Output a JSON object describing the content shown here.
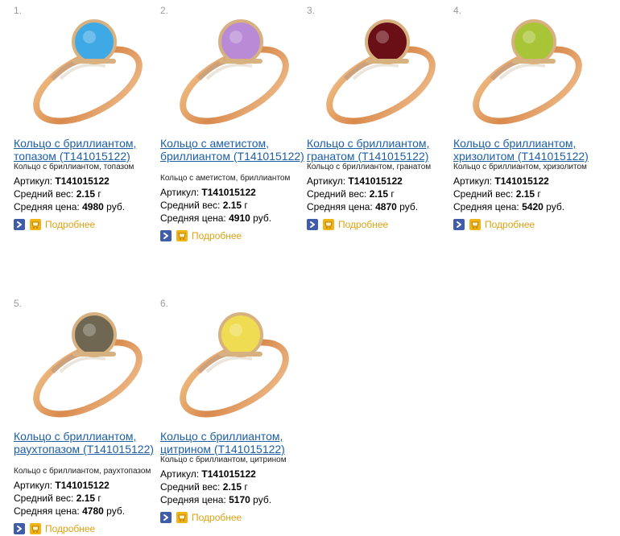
{
  "products": [
    {
      "index": "1.",
      "title": "Кольцо с бриллиантом, топазом (Т141015122)",
      "tags": "Кольцо с бриллиантом, топазом",
      "sku_label": "Артикул:",
      "sku": "Т141015122",
      "weight_label": "Средний вес:",
      "weight": "2.15",
      "weight_unit": "г",
      "price_label": "Средняя цена:",
      "price": "4980",
      "currency": "руб.",
      "more_label": "Подробнее",
      "stone_color": "#3fa9e6"
    },
    {
      "index": "2.",
      "title": "Кольцо с аметистом, бриллиантом (Т141015122)",
      "tags": "Кольцо с аметистом, бриллиантом",
      "sku_label": "Артикул:",
      "sku": "Т141015122",
      "weight_label": "Средний вес:",
      "weight": "2.15",
      "weight_unit": "г",
      "price_label": "Средняя цена:",
      "price": "4910",
      "currency": "руб.",
      "more_label": "Подробнее",
      "stone_color": "#b98bd6"
    },
    {
      "index": "3.",
      "title": "Кольцо с бриллиантом, гранатом (Т141015122)",
      "tags": "Кольцо с бриллиантом, гранатом",
      "sku_label": "Артикул:",
      "sku": "Т141015122",
      "weight_label": "Средний вес:",
      "weight": "2.15",
      "weight_unit": "г",
      "price_label": "Средняя цена:",
      "price": "4870",
      "currency": "руб.",
      "more_label": "Подробнее",
      "stone_color": "#6b0f16"
    },
    {
      "index": "4.",
      "title": "Кольцо с бриллиантом, хризолитом (Т141015122)",
      "tags": "Кольцо с бриллиантом, хризолитом",
      "sku_label": "Артикул:",
      "sku": "Т141015122",
      "weight_label": "Средний вес:",
      "weight": "2.15",
      "weight_unit": "г",
      "price_label": "Средняя цена:",
      "price": "5420",
      "currency": "руб.",
      "more_label": "Подробнее",
      "stone_color": "#a8c437"
    },
    {
      "index": "5.",
      "title": "Кольцо с бриллиантом, раухтопазом (Т141015122)",
      "tags": "Кольцо с бриллиантом, раухтопазом",
      "sku_label": "Артикул:",
      "sku": "Т141015122",
      "weight_label": "Средний вес:",
      "weight": "2.15",
      "weight_unit": "г",
      "price_label": "Средняя цена:",
      "price": "4780",
      "currency": "руб.",
      "more_label": "Подробнее",
      "stone_color": "#6f6752"
    },
    {
      "index": "6.",
      "title": "Кольцо с бриллиантом, цитрином (Т141015122)",
      "tags": "Кольцо с бриллиантом, цитрином",
      "sku_label": "Артикул:",
      "sku": "Т141015122",
      "weight_label": "Средний вес:",
      "weight": "2.15",
      "weight_unit": "г",
      "price_label": "Средняя цена:",
      "price": "5170",
      "currency": "руб.",
      "more_label": "Подробнее",
      "stone_color": "#efdc52"
    }
  ]
}
